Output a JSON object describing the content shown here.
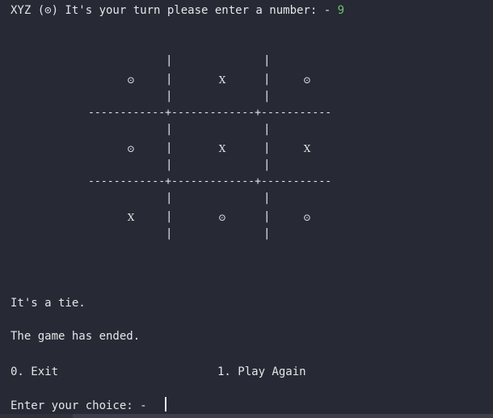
{
  "header": {
    "prompt": "XYZ (⊙) It's your turn please enter a number: - ",
    "input_value": "9"
  },
  "board": {
    "cells": [
      "⊙",
      "X",
      "⊙",
      "⊙",
      "X",
      "X",
      "X",
      "⊙",
      "⊙"
    ],
    "separator_row": "------------+-------------+-----------",
    "bar": "|"
  },
  "messages": {
    "result": "It's a tie.",
    "game_status": "The game has ended."
  },
  "menu": {
    "exit": "0. Exit",
    "play_again": "1. Play Again"
  },
  "choice": {
    "prompt": "Enter your choice: -"
  }
}
